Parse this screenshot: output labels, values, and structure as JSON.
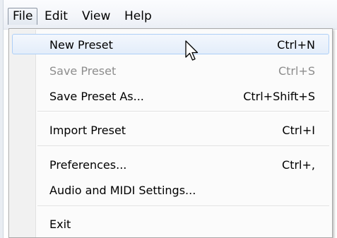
{
  "menubar": {
    "items": [
      {
        "label": "File"
      },
      {
        "label": "Edit"
      },
      {
        "label": "View"
      },
      {
        "label": "Help"
      }
    ]
  },
  "file_menu": {
    "items": [
      {
        "label": "New Preset",
        "shortcut": "Ctrl+N"
      },
      {
        "label": "Save Preset",
        "shortcut": "Ctrl+S"
      },
      {
        "label": "Save Preset As...",
        "shortcut": "Ctrl+Shift+S"
      },
      {
        "label": "Import Preset",
        "shortcut": "Ctrl+I"
      },
      {
        "label": "Preferences...",
        "shortcut": "Ctrl+,"
      },
      {
        "label": "Audio and MIDI Settings...",
        "shortcut": ""
      },
      {
        "label": "Exit",
        "shortcut": ""
      }
    ]
  },
  "cursor": {
    "icon": "arrow-cursor-icon"
  }
}
